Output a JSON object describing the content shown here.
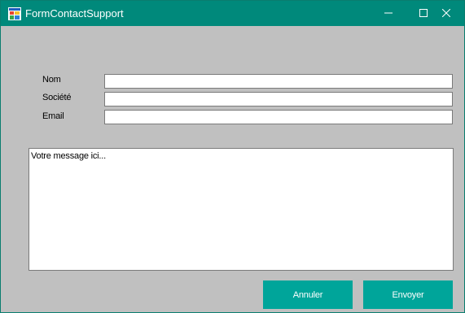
{
  "window": {
    "title": "FormContactSupport",
    "icons": {
      "app": "form-app-icon",
      "minimize": "minimize-icon",
      "maximize": "maximize-icon",
      "close": "close-icon"
    }
  },
  "form": {
    "fields": [
      {
        "label": "Nom",
        "value": ""
      },
      {
        "label": "Société",
        "value": ""
      },
      {
        "label": "Email",
        "value": ""
      }
    ],
    "message": {
      "value": "Votre message ici..."
    }
  },
  "buttons": {
    "cancel_label": "Annuler",
    "send_label": "Envoyer"
  },
  "colors": {
    "titlebar": "#00897b",
    "button": "#00a59a",
    "background": "#c0c0c0"
  }
}
